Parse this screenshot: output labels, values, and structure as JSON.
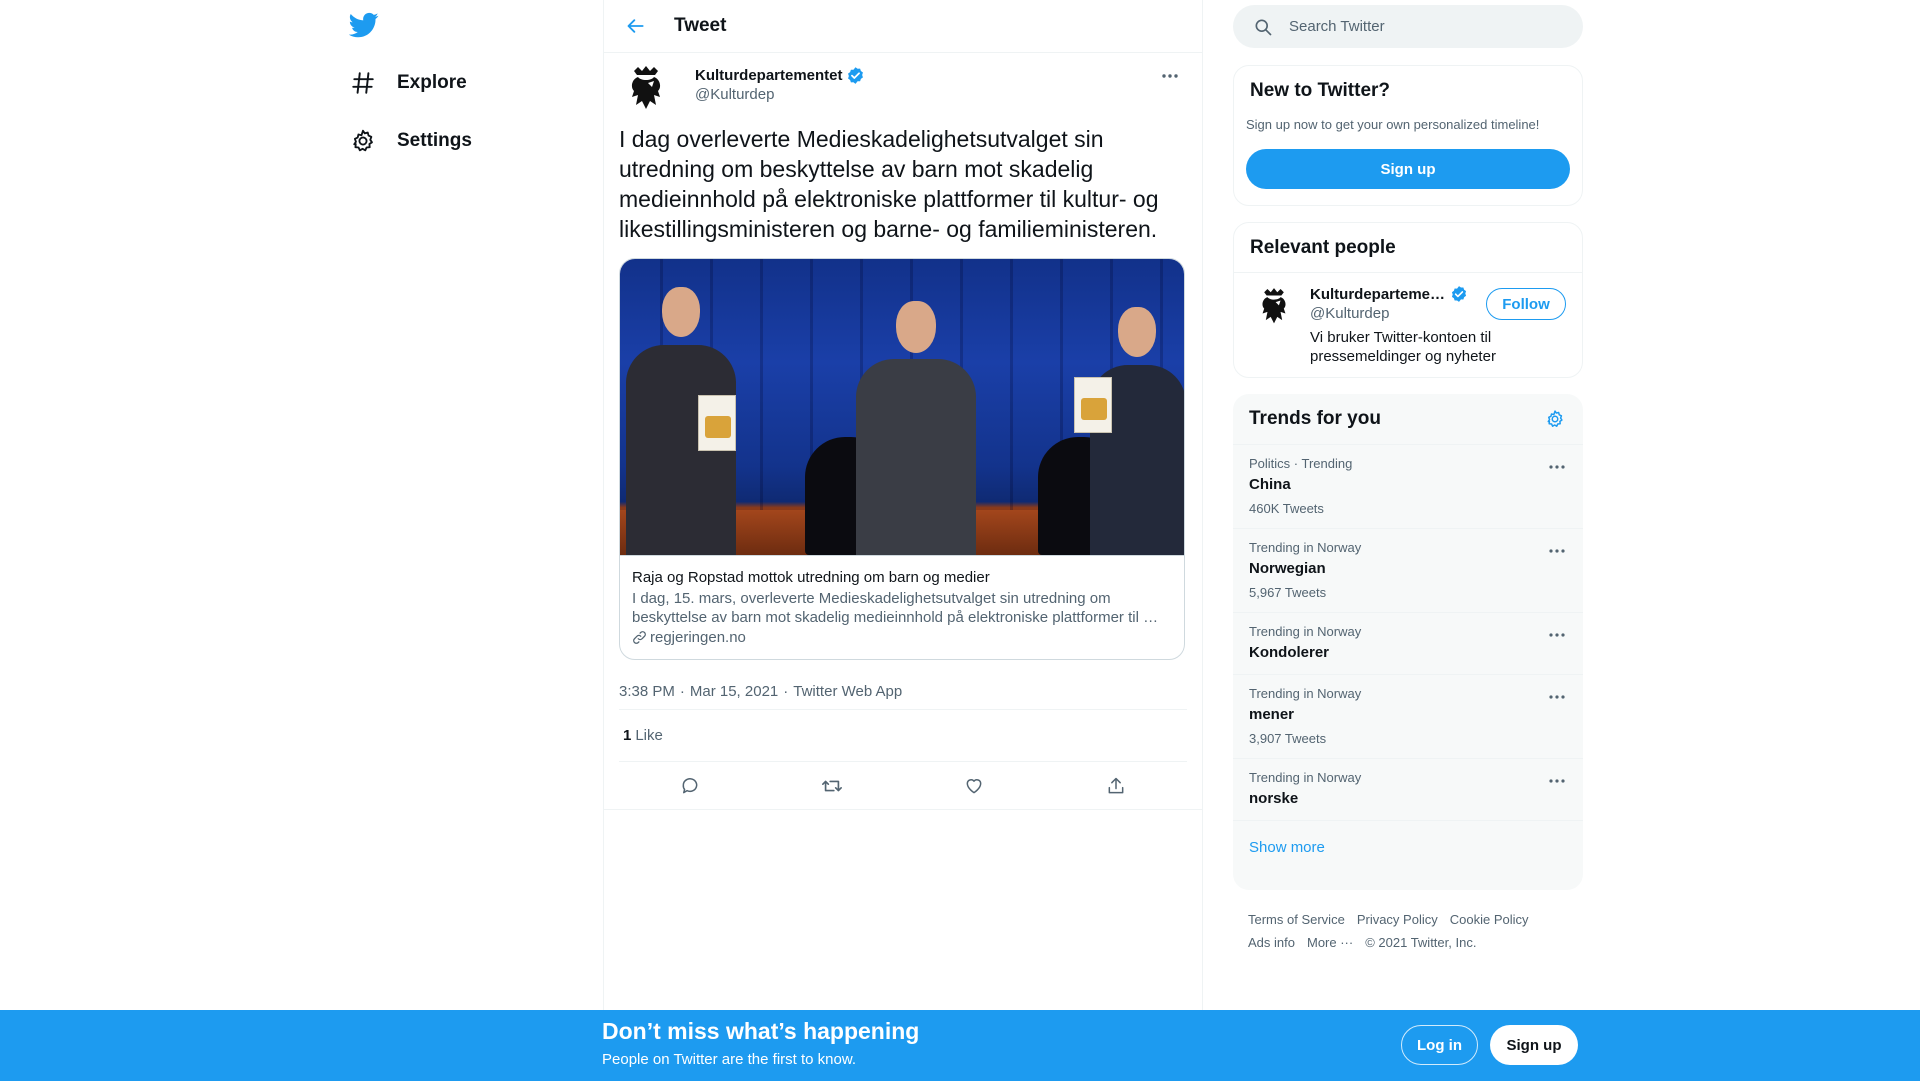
{
  "colors": {
    "accent": "#1d9bf0",
    "text_primary": "#0f1419",
    "text_secondary": "#536471",
    "border": "#eff3f4",
    "panel_bg": "#f7f9f9"
  },
  "nav": {
    "logo_icon": "twitter-bird-icon",
    "items": [
      {
        "label": "Explore",
        "icon": "hashtag-icon"
      },
      {
        "label": "Settings",
        "icon": "gear-icon"
      }
    ]
  },
  "header": {
    "title": "Tweet",
    "back_icon": "arrow-left-icon"
  },
  "tweet": {
    "author_name": "Kulturdepartementet",
    "author_handle": "@Kulturdep",
    "text": "I dag overleverte Medieskadelighetsutvalget sin utredning om beskyttelse av barn mot skadelig medieinnhold på elektroniske plattformer til kultur- og likestillingsministeren og barne- og familieministeren.",
    "card": {
      "title": "Raja og Ropstad mottok utredning om barn og medier",
      "description": "I dag, 15. mars, overleverte Medieskadelighetsutvalget sin utredning om beskyttelse av barn mot skadelig medieinnhold på elektroniske plattformer til …",
      "domain": "regjeringen.no"
    },
    "time": "3:38 PM",
    "date": "Mar 15, 2021",
    "source": "Twitter Web App",
    "separator": "·",
    "likes_count": "1",
    "likes_label": "Like"
  },
  "search": {
    "placeholder": "Search Twitter"
  },
  "new_to_twitter": {
    "title": "New to Twitter?",
    "subtitle": "Sign up now to get your own personalized timeline!",
    "signup_label": "Sign up"
  },
  "relevant_people": {
    "title": "Relevant people",
    "person": {
      "name": "Kulturdepartementet",
      "handle": "@Kulturdep",
      "bio": "Vi bruker Twitter-kontoen til pressemeldinger og nyheter",
      "follow_label": "Follow"
    }
  },
  "trends": {
    "title": "Trends for you",
    "items": [
      {
        "meta": "Politics · Trending",
        "name": "China",
        "count": "460K Tweets"
      },
      {
        "meta": "Trending in Norway",
        "name": "Norwegian",
        "count": "5,967 Tweets"
      },
      {
        "meta": "Trending in Norway",
        "name": "Kondolerer",
        "count": ""
      },
      {
        "meta": "Trending in Norway",
        "name": "mener",
        "count": "3,907 Tweets"
      },
      {
        "meta": "Trending in Norway",
        "name": "norske",
        "count": ""
      }
    ],
    "show_more": "Show more"
  },
  "footer": {
    "terms": "Terms of Service",
    "privacy": "Privacy Policy",
    "cookie": "Cookie Policy",
    "ads": "Ads info",
    "more": "More ···",
    "copyright": "© 2021 Twitter, Inc."
  },
  "banner": {
    "title": "Don’t miss what’s happening",
    "subtitle": "People on Twitter are the first to know.",
    "login_label": "Log in",
    "signup_label": "Sign up"
  }
}
